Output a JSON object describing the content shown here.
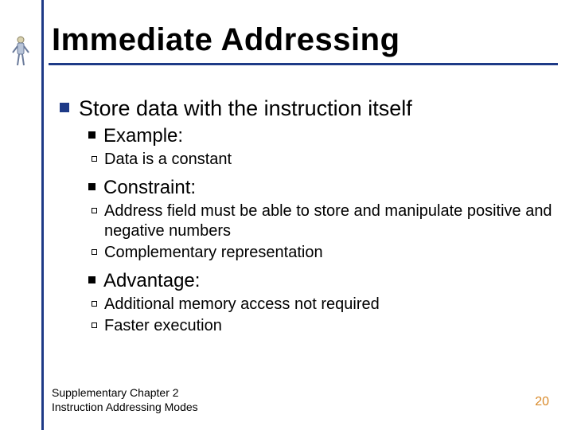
{
  "title": "Immediate Addressing",
  "bullets": {
    "l1": "Store data with the instruction itself",
    "l2_example": "Example:",
    "l3_example_1": "Data is a constant",
    "l2_constraint": "Constraint:",
    "l3_constraint_1": "Address field must be able to store and manipulate positive and negative numbers",
    "l3_constraint_2": "Complementary representation",
    "l2_advantage": "Advantage:",
    "l3_advantage_1": "Additional memory access not required",
    "l3_advantage_2": "Faster execution"
  },
  "footer": {
    "line1": "Supplementary Chapter 2",
    "line2": "Instruction Addressing Modes",
    "page": "20"
  }
}
